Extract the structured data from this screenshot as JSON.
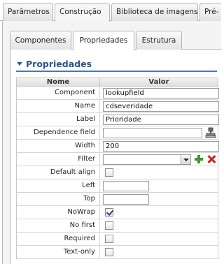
{
  "top_tabs": [
    "Parâmetros",
    "Construção",
    "Biblioteca de imagens",
    "Pré-"
  ],
  "active_top_tab": 1,
  "sub_tabs": [
    "Componentes",
    "Propriedades",
    "Estrutura"
  ],
  "active_sub_tab": 1,
  "section": {
    "title": "Propriedades",
    "collapsed": false
  },
  "grid": {
    "headers": {
      "name": "Nome",
      "value": "Valor"
    },
    "rows": [
      {
        "label": "Component",
        "type": "text",
        "value": "lookupfield"
      },
      {
        "label": "Name",
        "type": "text",
        "value": "cdseveridade"
      },
      {
        "label": "Label",
        "type": "text",
        "value": "Prioridade"
      },
      {
        "label": "Dependence field",
        "type": "text-button",
        "value": ""
      },
      {
        "label": "Width",
        "type": "text",
        "value": "200"
      },
      {
        "label": "Filter",
        "type": "select",
        "value": ""
      },
      {
        "label": "Default align",
        "type": "checkbox",
        "checked": false
      },
      {
        "label": "Left",
        "type": "text-short",
        "value": ""
      },
      {
        "label": "Top",
        "type": "text-short",
        "value": ""
      },
      {
        "label": "NoWrap",
        "type": "checkbox",
        "checked": true
      },
      {
        "label": "No first",
        "type": "checkbox",
        "checked": false
      },
      {
        "label": "Required",
        "type": "checkbox",
        "checked": false
      },
      {
        "label": "Text-only",
        "type": "checkbox",
        "checked": false
      }
    ]
  },
  "icons": {
    "collapse": "chevron-down-icon",
    "dependence_button": "stamp-icon",
    "filter_add": "plus-icon",
    "filter_remove": "close-icon"
  },
  "colors": {
    "accent": "#4a77b4",
    "section_title": "#2a5490",
    "add_green": "#3a9a2a",
    "remove_red": "#d02020"
  }
}
